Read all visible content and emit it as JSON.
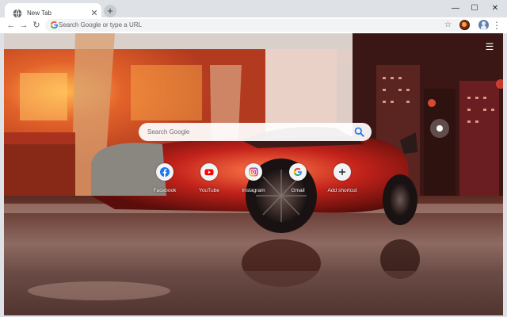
{
  "browser": {
    "tab": {
      "title": "New Tab",
      "close_glyph": "✕"
    },
    "new_tab_glyph": "+",
    "window_controls": {
      "minimize": "—",
      "maximize": "☐",
      "close": "✕"
    }
  },
  "toolbar": {
    "back_glyph": "←",
    "forward_glyph": "→",
    "reload_glyph": "↻",
    "omnibox_placeholder": "Search Google or type a URL",
    "bookmark_glyph": "☆",
    "menu_glyph": "⋮"
  },
  "ntp": {
    "search_placeholder": "Search Google",
    "settings_glyph": "☰",
    "shortcuts": [
      {
        "label": "Facebook",
        "icon": "facebook-icon",
        "color": "#1877f2"
      },
      {
        "label": "YouTube",
        "icon": "youtube-icon",
        "color": "#ff0000"
      },
      {
        "label": "Instagram",
        "icon": "instagram-icon",
        "color": "#c13584"
      },
      {
        "label": "Gmail",
        "icon": "google-icon",
        "color": "#4285f4"
      },
      {
        "label": "Add shortcut",
        "icon": "plus-icon",
        "color": "#202124"
      }
    ]
  },
  "colors": {
    "tabstrip": "#dee1e6",
    "toolbar": "#ffffff",
    "accent_red": "#d93025",
    "blue": "#1a73e8"
  }
}
